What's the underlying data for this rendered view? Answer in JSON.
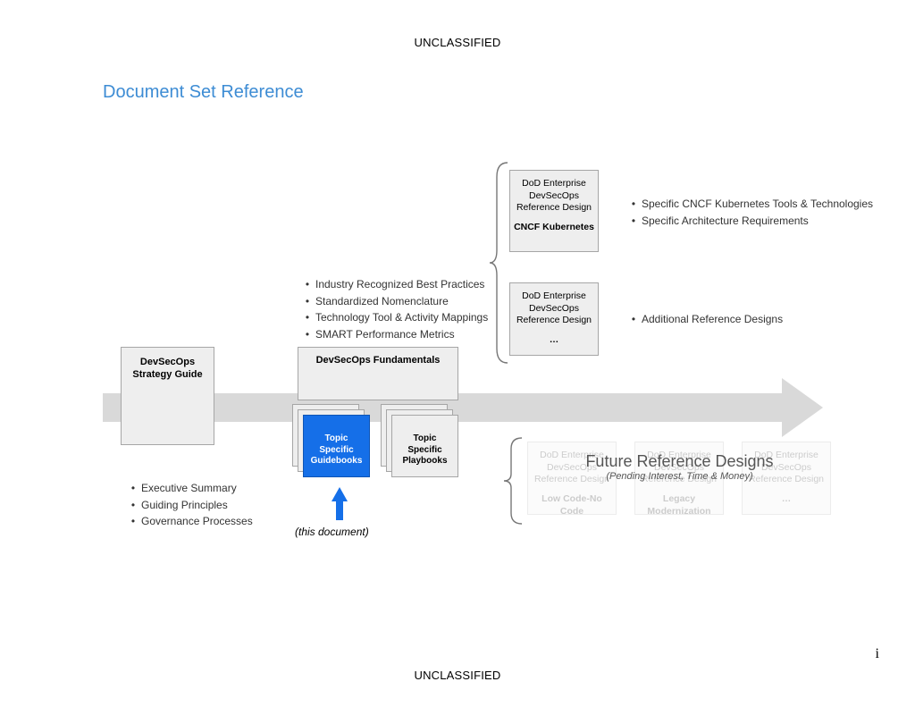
{
  "classification": "UNCLASSIFIED",
  "title": "Document Set Reference",
  "page_number": "i",
  "strategy": {
    "title": "DevSecOps Strategy Guide",
    "bullets": [
      "Executive Summary",
      "Guiding Principles",
      "Governance Processes"
    ]
  },
  "fundamentals": {
    "title": "DevSecOps Fundamentals",
    "guidebooks": "Topic Specific Guidebooks",
    "playbooks": "Topic Specific Playbooks",
    "this_document": "(this document)",
    "bullets": [
      "Industry Recognized Best Practices",
      "Standardized Nomenclature",
      "Technology Tool & Activity Mappings",
      "SMART Performance Metrics"
    ]
  },
  "reference_designs": {
    "cncf": {
      "header": "DoD Enterprise DevSecOps Reference Design",
      "strong": "CNCF Kubernetes",
      "bullets": [
        "Specific CNCF Kubernetes Tools & Technologies",
        "Specific Architecture Requirements"
      ]
    },
    "additional": {
      "header": "DoD Enterprise DevSecOps Reference Design",
      "strong": "…",
      "bullets": [
        "Additional Reference Designs"
      ]
    }
  },
  "future": {
    "title": "Future Reference Designs",
    "subtitle": "(Pending Interest,  Time & Money)",
    "cards": [
      {
        "header": "DoD Enterprise DevSecOps Reference Design",
        "strong": "Low Code-No Code"
      },
      {
        "header": "DoD Enterprise DevSecOps Reference Design",
        "strong": "Legacy Modernization"
      },
      {
        "header": "DoD Enterprise DevSecOps Reference Design",
        "strong": "…"
      }
    ]
  }
}
